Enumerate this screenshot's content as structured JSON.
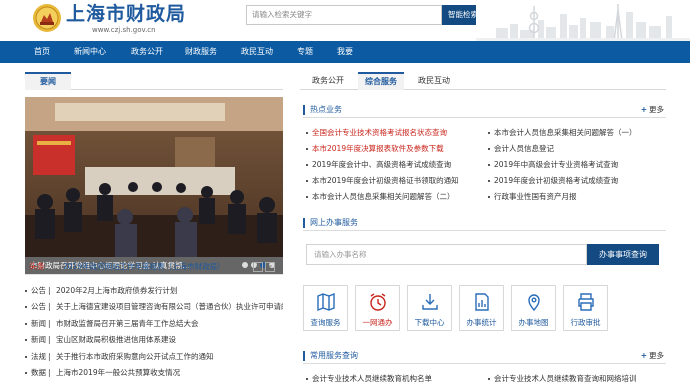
{
  "header": {
    "site_title": "上海市财政局",
    "site_url": "www.czj.sh.gov.cn",
    "search_placeholder": "请输入检索关键字",
    "search_button": "智能检索"
  },
  "nav": {
    "items": [
      "首页",
      "新闻中心",
      "政务公开",
      "财政服务",
      "政民互动",
      "专题",
      "我要"
    ]
  },
  "news": {
    "tab": "要闻",
    "photo_caption": "市财政局召开党组中心组理论学习会 认真贯彻…",
    "headline_label": "头条",
    "headline_text": "2019年政府网站工作年度报表（上海市财政局）",
    "headline_arrows": [
      "<",
      ">"
    ],
    "items": [
      {
        "category": "公告",
        "title": "2020年2月上海市政府债券发行计划"
      },
      {
        "category": "公告",
        "title": "关于上海德宜建设项目管理咨询有限公司（普通合伙）执业许可申请的公示"
      },
      {
        "category": "新闻",
        "title": "市财政监督局召开第三届青年工作总结大会"
      },
      {
        "category": "新闻",
        "title": "宝山区财政局积极推进信用体系建设"
      },
      {
        "category": "法规",
        "title": "关于推行本市政府采购意向公开试点工作的通知"
      },
      {
        "category": "数据",
        "title": "上海市2019年一般公共预算收支情况"
      }
    ]
  },
  "services": {
    "tabs": [
      "政务公开",
      "综合服务",
      "政民互动"
    ],
    "active_tab": "综合服务",
    "hot": {
      "title": "热点业务",
      "more": "更多",
      "left": [
        {
          "text": "全国会计专业技术资格考试报名状态查询",
          "highlight": true
        },
        {
          "text": "本市2019年度决算报表软件及参数下载",
          "highlight": true
        },
        {
          "text": "2019年度会计中、高级资格考试成绩查询",
          "highlight": false
        },
        {
          "text": "本市2019年度会计初级资格证书领取的通知",
          "highlight": false
        },
        {
          "text": "本市会计人员信息采集相关问题解答（二）",
          "highlight": false
        }
      ],
      "right": [
        {
          "text": "本市会计人员信息采集相关问题解答（一）",
          "highlight": false
        },
        {
          "text": "会计人员信息登记",
          "highlight": false
        },
        {
          "text": "2019年中高级会计专业资格考试查询",
          "highlight": false
        },
        {
          "text": "2019年度会计初级资格考试成绩查询",
          "highlight": false
        },
        {
          "text": "行政事业性国有资产月报",
          "highlight": false
        }
      ]
    },
    "online": {
      "title": "网上办事服务",
      "placeholder": "请输入办事名称",
      "button": "办事事项查询",
      "tiles": [
        {
          "label": "查询服务",
          "icon": "map-icon",
          "accent": false
        },
        {
          "label": "一网通办",
          "icon": "clock-icon",
          "accent": true
        },
        {
          "label": "下载中心",
          "icon": "download-icon",
          "accent": false
        },
        {
          "label": "办事统计",
          "icon": "chart-doc-icon",
          "accent": false
        },
        {
          "label": "办事地图",
          "icon": "location-icon",
          "accent": false
        },
        {
          "label": "行政审批",
          "icon": "printer-icon",
          "accent": false
        }
      ]
    },
    "common": {
      "title": "常用服务查询",
      "more": "更多",
      "items": [
        "会计专业技术人员继续教育机构名单",
        "会计专业技术人员继续教育查询和网络培训"
      ]
    }
  },
  "colors": {
    "brand_blue": "#0b5aa2",
    "title_blue": "#1f5a9e",
    "highlight_red": "#c9251c"
  }
}
